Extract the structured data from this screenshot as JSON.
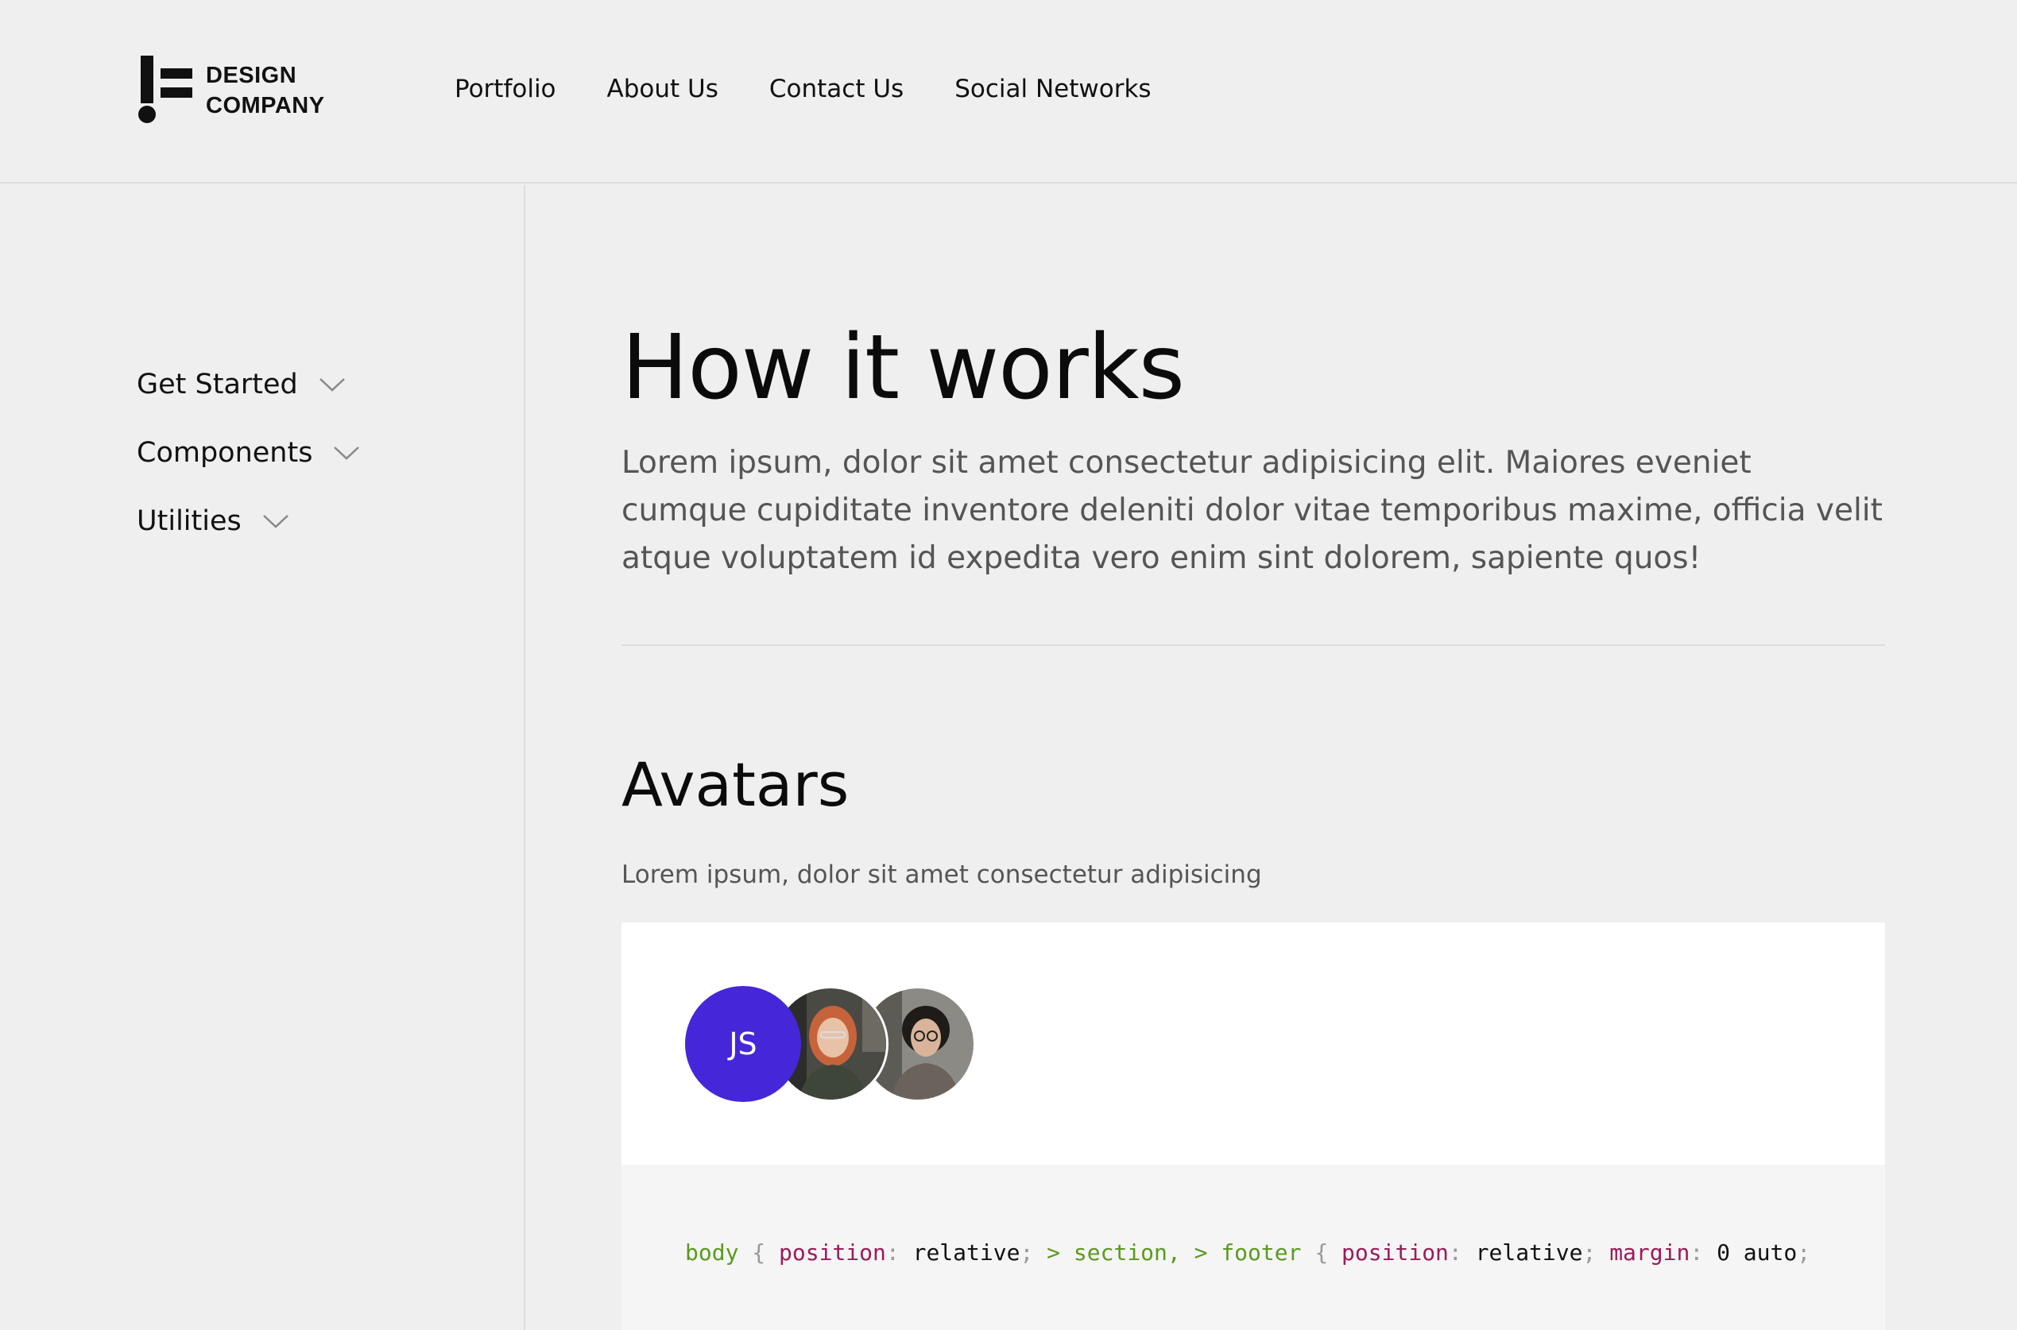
{
  "brand": {
    "line1": "DESIGN",
    "line2": "COMPANY"
  },
  "nav": {
    "items": [
      "Portfolio",
      "About Us",
      "Contact Us",
      "Social Networks"
    ]
  },
  "sidebar": {
    "items": [
      {
        "label": "Get Started",
        "icon": "chevron-down-icon"
      },
      {
        "label": "Components",
        "icon": "chevron-down-icon"
      },
      {
        "label": "Utilities",
        "icon": "chevron-down-icon"
      }
    ]
  },
  "main": {
    "title": "How it works",
    "intro": "Lorem ipsum, dolor sit amet consectetur adipisicing elit. Maiores eveniet cumque cupiditate inventore deleniti dolor vitae temporibus maxime, officia velit atque voluptatem id expedita vero enim sint dolorem, sapiente quos!",
    "section": {
      "title": "Avatars",
      "description": "Lorem ipsum, dolor sit amet consectetur adipisicing",
      "avatars": [
        {
          "type": "initials",
          "text": "JS"
        },
        {
          "type": "photo",
          "icon": "woman-red-hair-photo"
        },
        {
          "type": "photo",
          "icon": "woman-curly-hair-photo"
        }
      ],
      "code": {
        "tokens": [
          {
            "t": "body",
            "c": "sel"
          },
          {
            "t": " { ",
            "c": "punc"
          },
          {
            "t": "position",
            "c": "prop"
          },
          {
            "t": ": ",
            "c": "punc"
          },
          {
            "t": "relative",
            "c": "val"
          },
          {
            "t": "; ",
            "c": "punc"
          },
          {
            "t": "> section, > footer",
            "c": "sel"
          },
          {
            "t": " { ",
            "c": "punc"
          },
          {
            "t": "position",
            "c": "prop"
          },
          {
            "t": ": ",
            "c": "punc"
          },
          {
            "t": "relative",
            "c": "val"
          },
          {
            "t": "; ",
            "c": "punc"
          },
          {
            "t": "margin",
            "c": "prop"
          },
          {
            "t": ": ",
            "c": "punc"
          },
          {
            "t": "0 auto",
            "c": "val"
          },
          {
            "t": ";",
            "c": "punc"
          }
        ]
      }
    }
  },
  "colors": {
    "accent": "#4527d9",
    "background": "#efefef",
    "code_selector": "#5a9a1e",
    "code_property": "#9b1b5a"
  }
}
